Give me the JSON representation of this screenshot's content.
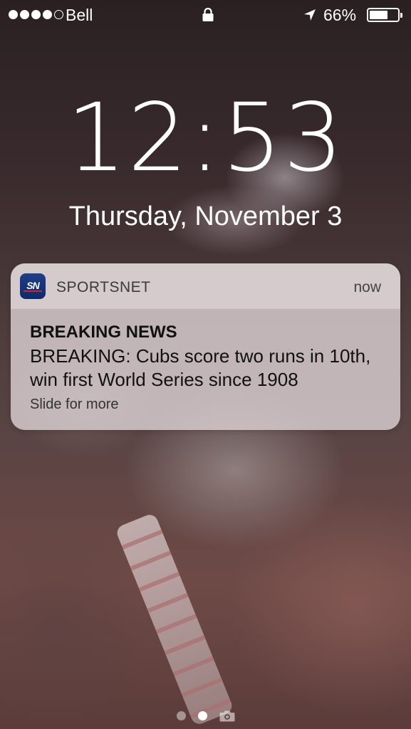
{
  "status_bar": {
    "signal_bars": 4,
    "signal_total": 5,
    "carrier": "Bell",
    "battery_percent": "66%",
    "battery_level": 0.66,
    "icons": [
      "lock-icon",
      "location-arrow-icon",
      "battery-icon"
    ]
  },
  "lock_screen": {
    "time": "12:53",
    "date": "Thursday, November 3"
  },
  "notification": {
    "app_name": "SPORTSNET",
    "app_icon_text": "SN",
    "timestamp": "now",
    "title": "BREAKING NEWS",
    "body": "BREAKING: Cubs score two runs in 10th, win first World Series since 1908",
    "hint": "Slide for more"
  },
  "page_indicator": {
    "pages": 2,
    "active_index": 1,
    "camera_icon": "camera-icon"
  }
}
